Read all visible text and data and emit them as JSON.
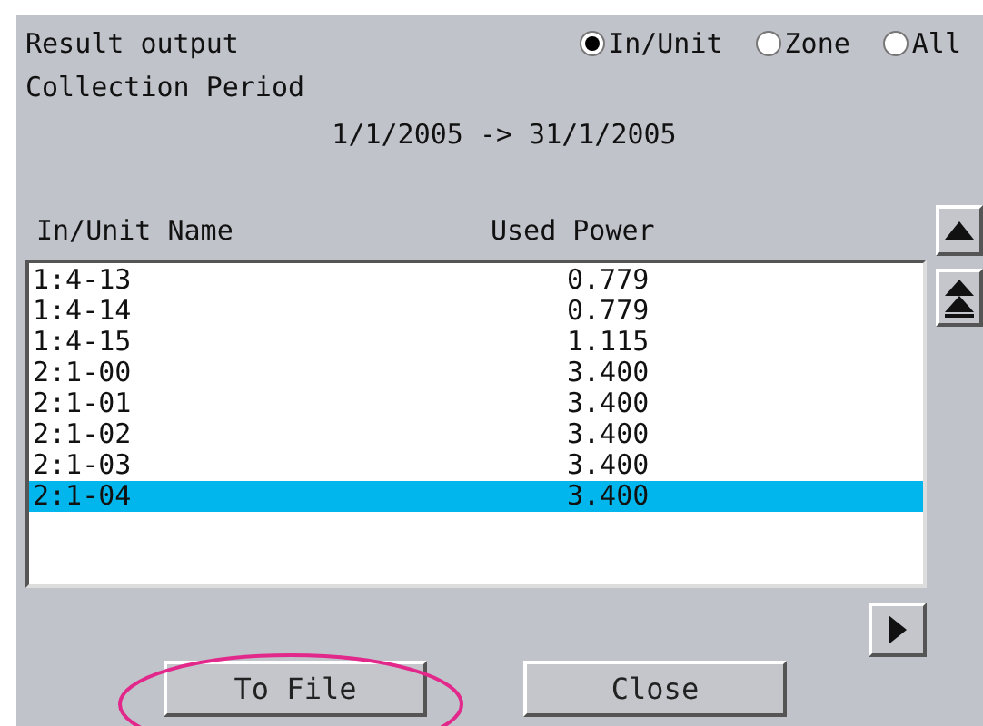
{
  "title": "Result output",
  "output_options": [
    {
      "label": "In/Unit",
      "selected": true
    },
    {
      "label": "Zone",
      "selected": false
    },
    {
      "label": "All",
      "selected": false
    }
  ],
  "period_label": "Collection Period",
  "period": "1/1/2005 -> 31/1/2005",
  "table": {
    "columns": [
      "In/Unit Name",
      "Used Power"
    ],
    "rows": [
      {
        "name": "1:4-13",
        "used_power": "0.779",
        "selected": false
      },
      {
        "name": "1:4-14",
        "used_power": "0.779",
        "selected": false
      },
      {
        "name": "1:4-15",
        "used_power": "1.115",
        "selected": false
      },
      {
        "name": "2:1-00",
        "used_power": "3.400",
        "selected": false
      },
      {
        "name": "2:1-01",
        "used_power": "3.400",
        "selected": false
      },
      {
        "name": "2:1-02",
        "used_power": "3.400",
        "selected": false
      },
      {
        "name": "2:1-03",
        "used_power": "3.400",
        "selected": false
      },
      {
        "name": "2:1-04",
        "used_power": "3.400",
        "selected": true
      }
    ]
  },
  "buttons": [
    "To File",
    "Close"
  ]
}
